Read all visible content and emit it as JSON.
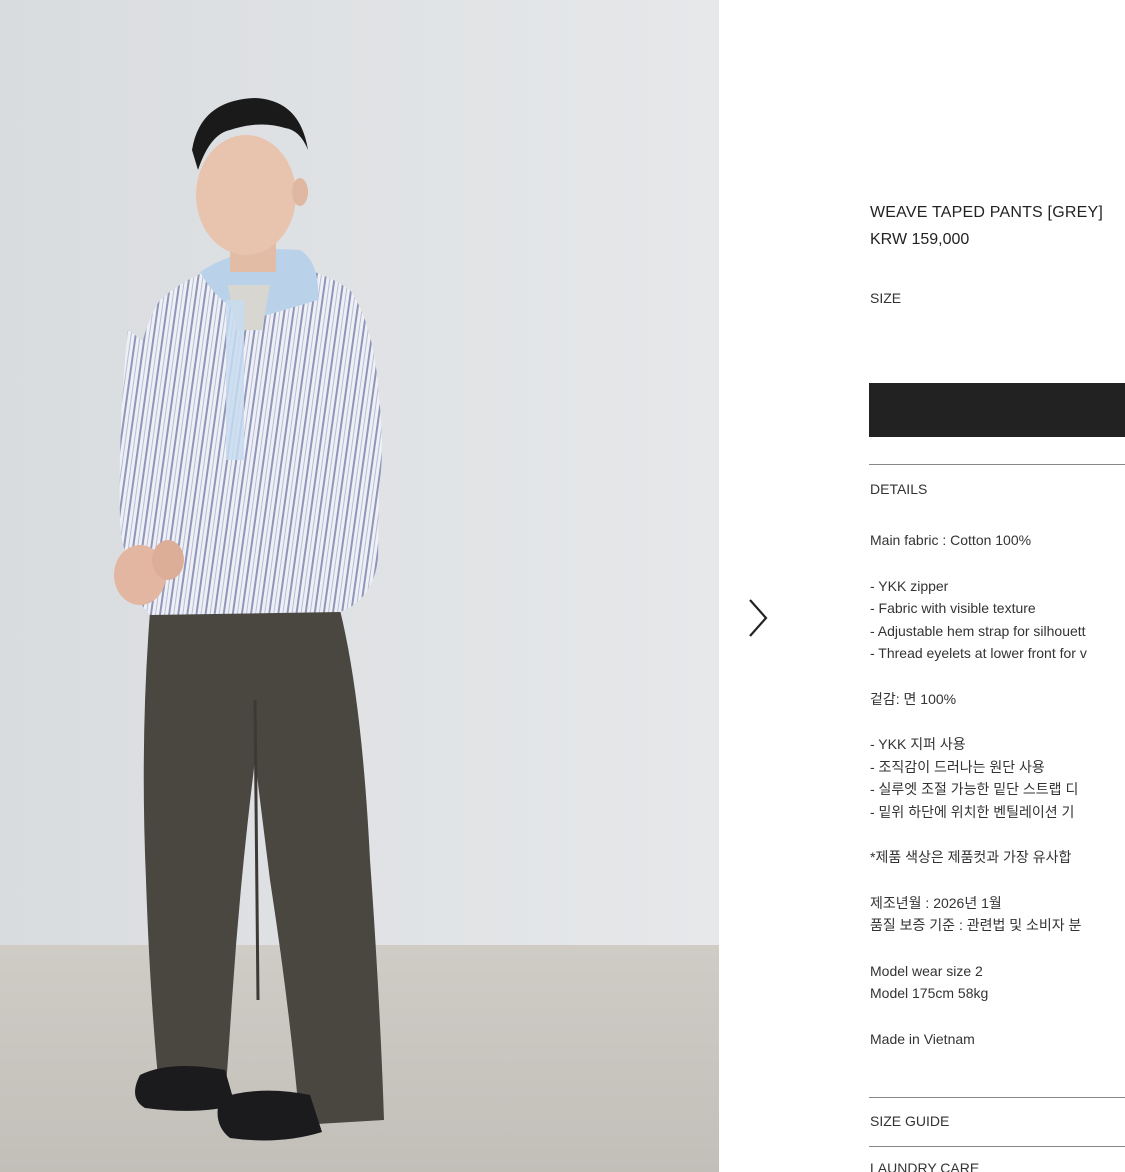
{
  "product": {
    "title": "WEAVE TAPED PANTS [GREY]",
    "price": "KRW 159,000",
    "size_label": "SIZE"
  },
  "sections": {
    "details": "DETAILS",
    "size_guide": "SIZE GUIDE",
    "laundry_care": "LAUNDRY CARE"
  },
  "details": {
    "fabric_en": "Main fabric : Cotton 100%",
    "features_en": [
      "- YKK zipper",
      "- Fabric with visible texture",
      "- Adjustable hem strap for silhouett",
      "- Thread eyelets at lower front for v"
    ],
    "fabric_ko": "겉감: 면 100%",
    "features_ko": [
      "- YKK 지퍼 사용",
      "- 조직감이 드러나는 원단 사용",
      "- 실루엣 조절 가능한 밑단 스트랩 디",
      "- 밑위 하단에 위치한 벤틸레이션 기"
    ],
    "color_note": "*제품 색상은 제품컷과 가장 유사합",
    "manufacture": "제조년월 : 2026년 1월",
    "quality": "품질 보증 기준 : 관련법 및 소비자 분",
    "model_size": "Model wear size 2",
    "model_body": "Model 175cm 58kg",
    "origin": "Made in Vietnam"
  },
  "icons": {
    "next": "chevron-right-icon"
  },
  "colors": {
    "buy_bar": "#222222",
    "photo_wall": "#dfe2e4",
    "photo_floor": "#c9c6c0"
  }
}
